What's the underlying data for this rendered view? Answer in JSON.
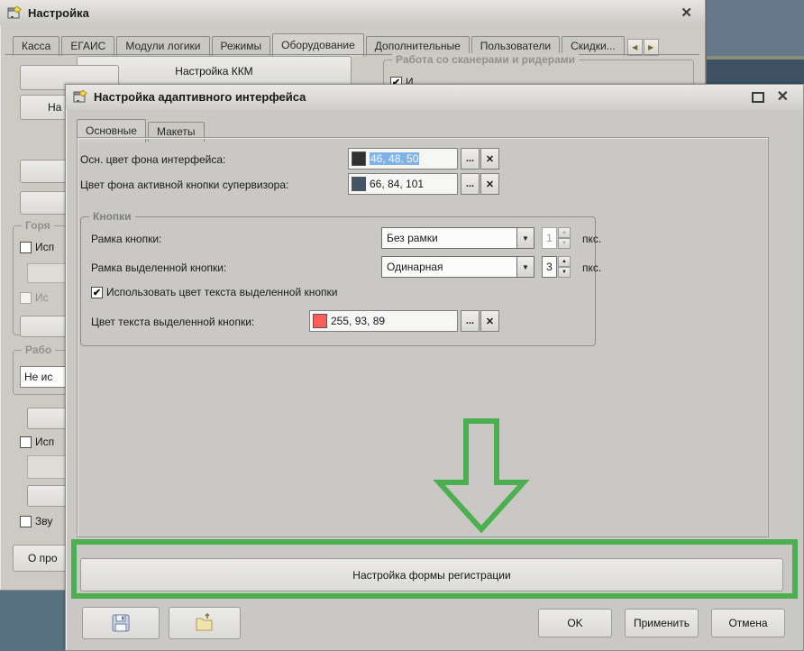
{
  "back_window": {
    "title": "Настройка",
    "tabs": [
      "Касса",
      "ЕГАИС",
      "Модули логики",
      "Режимы",
      "Оборудование",
      "Дополнительные",
      "Пользователи",
      "Скидки..."
    ],
    "kkm_button_label": "Настройка ККМ",
    "scanner_group_label": "Работа со сканерами и ридерами",
    "scanner_checkbox_label": "И",
    "left_fragments": {
      "button_na": "На",
      "group_gorya": "Горя",
      "checkbox_isp1": "Исп",
      "checkbox_is2": "Ис",
      "group_rabo": "Рабо",
      "combo_ne_is": "Не ис",
      "checkbox_isp3": "Исп",
      "checkbox_zvu": "Зву",
      "button_opro": "О про"
    }
  },
  "dialog": {
    "title": "Настройка адаптивного интерфейса",
    "tab_osnovnye": "Основные",
    "tab_makety": "Макеты",
    "field_bg": {
      "label": "Осн. цвет фона интерфейса:",
      "value": "46, 48, 50",
      "swatch": "#2E3032"
    },
    "field_supervisor": {
      "label": "Цвет фона активной кнопки супервизора:",
      "value": "66, 84, 101",
      "swatch": "#425465"
    },
    "group_buttons": {
      "label": "Кнопки",
      "row_frame": {
        "label": "Рамка кнопки:",
        "value": "Без рамки",
        "spin": "1",
        "unit": "пкс."
      },
      "row_selected_frame": {
        "label": "Рамка выделенной кнопки:",
        "value": "Одинарная",
        "spin": "3",
        "unit": "пкс."
      },
      "checkbox_label": "Использовать цвет текста выделенной кнопки",
      "field_text_color": {
        "label": "Цвет текста выделенной кнопки:",
        "value": "255, 93, 89",
        "swatch": "#FF5D59"
      }
    },
    "registration_button_label": "Настройка формы регистрации",
    "ok": "OK",
    "apply": "Применить",
    "cancel": "Отмена"
  },
  "glyphs": {
    "close": "✕",
    "dots": "...",
    "clear": "✕",
    "dropdown": "▼",
    "spin_up": "▲",
    "spin_down": "▼",
    "tab_left": "◀",
    "tab_right": "▶",
    "check": "✔"
  },
  "colors": {
    "annotation_green": "#4CAF50",
    "selection": "#7FB2E5"
  }
}
